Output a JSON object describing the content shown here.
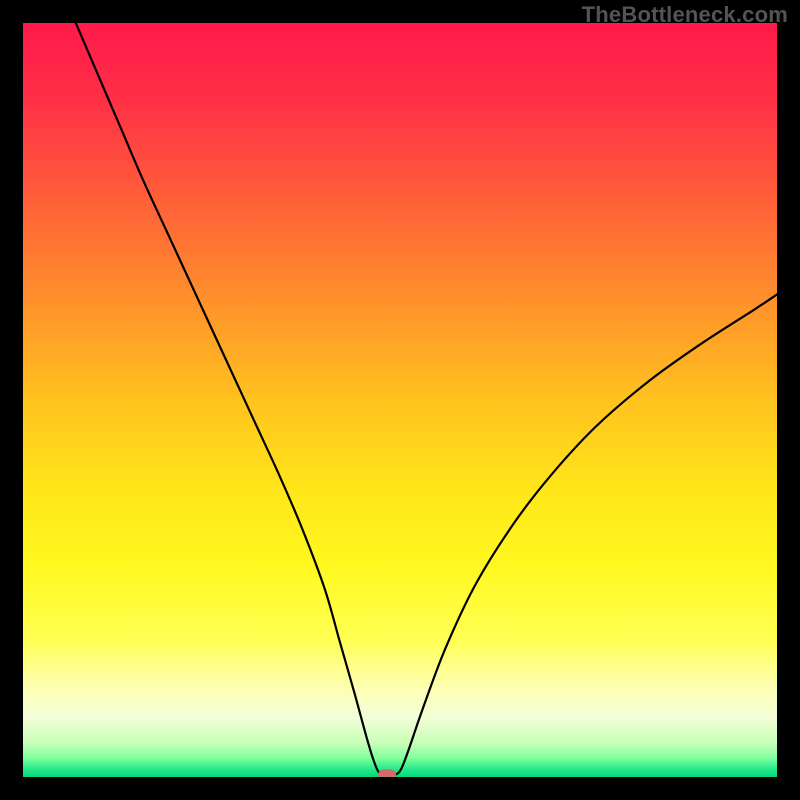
{
  "watermark": "TheBottleneck.com",
  "chart_data": {
    "type": "line",
    "title": "",
    "xlabel": "",
    "ylabel": "",
    "xlim": [
      0,
      100
    ],
    "ylim": [
      0,
      100
    ],
    "grid": false,
    "curve": {
      "name": "bottleneck-curve",
      "x": [
        7,
        10,
        13,
        16,
        19,
        22,
        25,
        28,
        31,
        34,
        37,
        40,
        42,
        44,
        45.5,
        46.5,
        47.2,
        48,
        49,
        50,
        51,
        53,
        56,
        60,
        65,
        70,
        76,
        83,
        90,
        97,
        100
      ],
      "y": [
        100,
        93,
        86,
        79,
        72.5,
        66,
        59.5,
        53,
        46.5,
        40,
        33,
        25,
        18,
        11,
        5.5,
        2.2,
        0.6,
        0.25,
        0.25,
        0.8,
        3.2,
        9,
        17,
        25.5,
        33.5,
        40,
        46.5,
        52.5,
        57.5,
        62,
        64
      ]
    },
    "marker": {
      "name": "optimal-point",
      "x": 48.3,
      "y": 0.4,
      "color": "#d46a6a",
      "rx": 9,
      "ry": 5
    },
    "gradient_stops": [
      {
        "offset": 0.0,
        "color": "#ff1a4b"
      },
      {
        "offset": 0.1,
        "color": "#ff2f46"
      },
      {
        "offset": 0.22,
        "color": "#ff5a3a"
      },
      {
        "offset": 0.35,
        "color": "#ff8a2e"
      },
      {
        "offset": 0.5,
        "color": "#ffc21e"
      },
      {
        "offset": 0.62,
        "color": "#ffe61a"
      },
      {
        "offset": 0.72,
        "color": "#fff81f"
      },
      {
        "offset": 0.82,
        "color": "#ffff55"
      },
      {
        "offset": 0.88,
        "color": "#fdffb0"
      },
      {
        "offset": 0.92,
        "color": "#f4ffd8"
      },
      {
        "offset": 0.955,
        "color": "#c8ffb8"
      },
      {
        "offset": 0.975,
        "color": "#7fff9e"
      },
      {
        "offset": 0.99,
        "color": "#21e98a"
      },
      {
        "offset": 1.0,
        "color": "#06d67a"
      }
    ]
  }
}
